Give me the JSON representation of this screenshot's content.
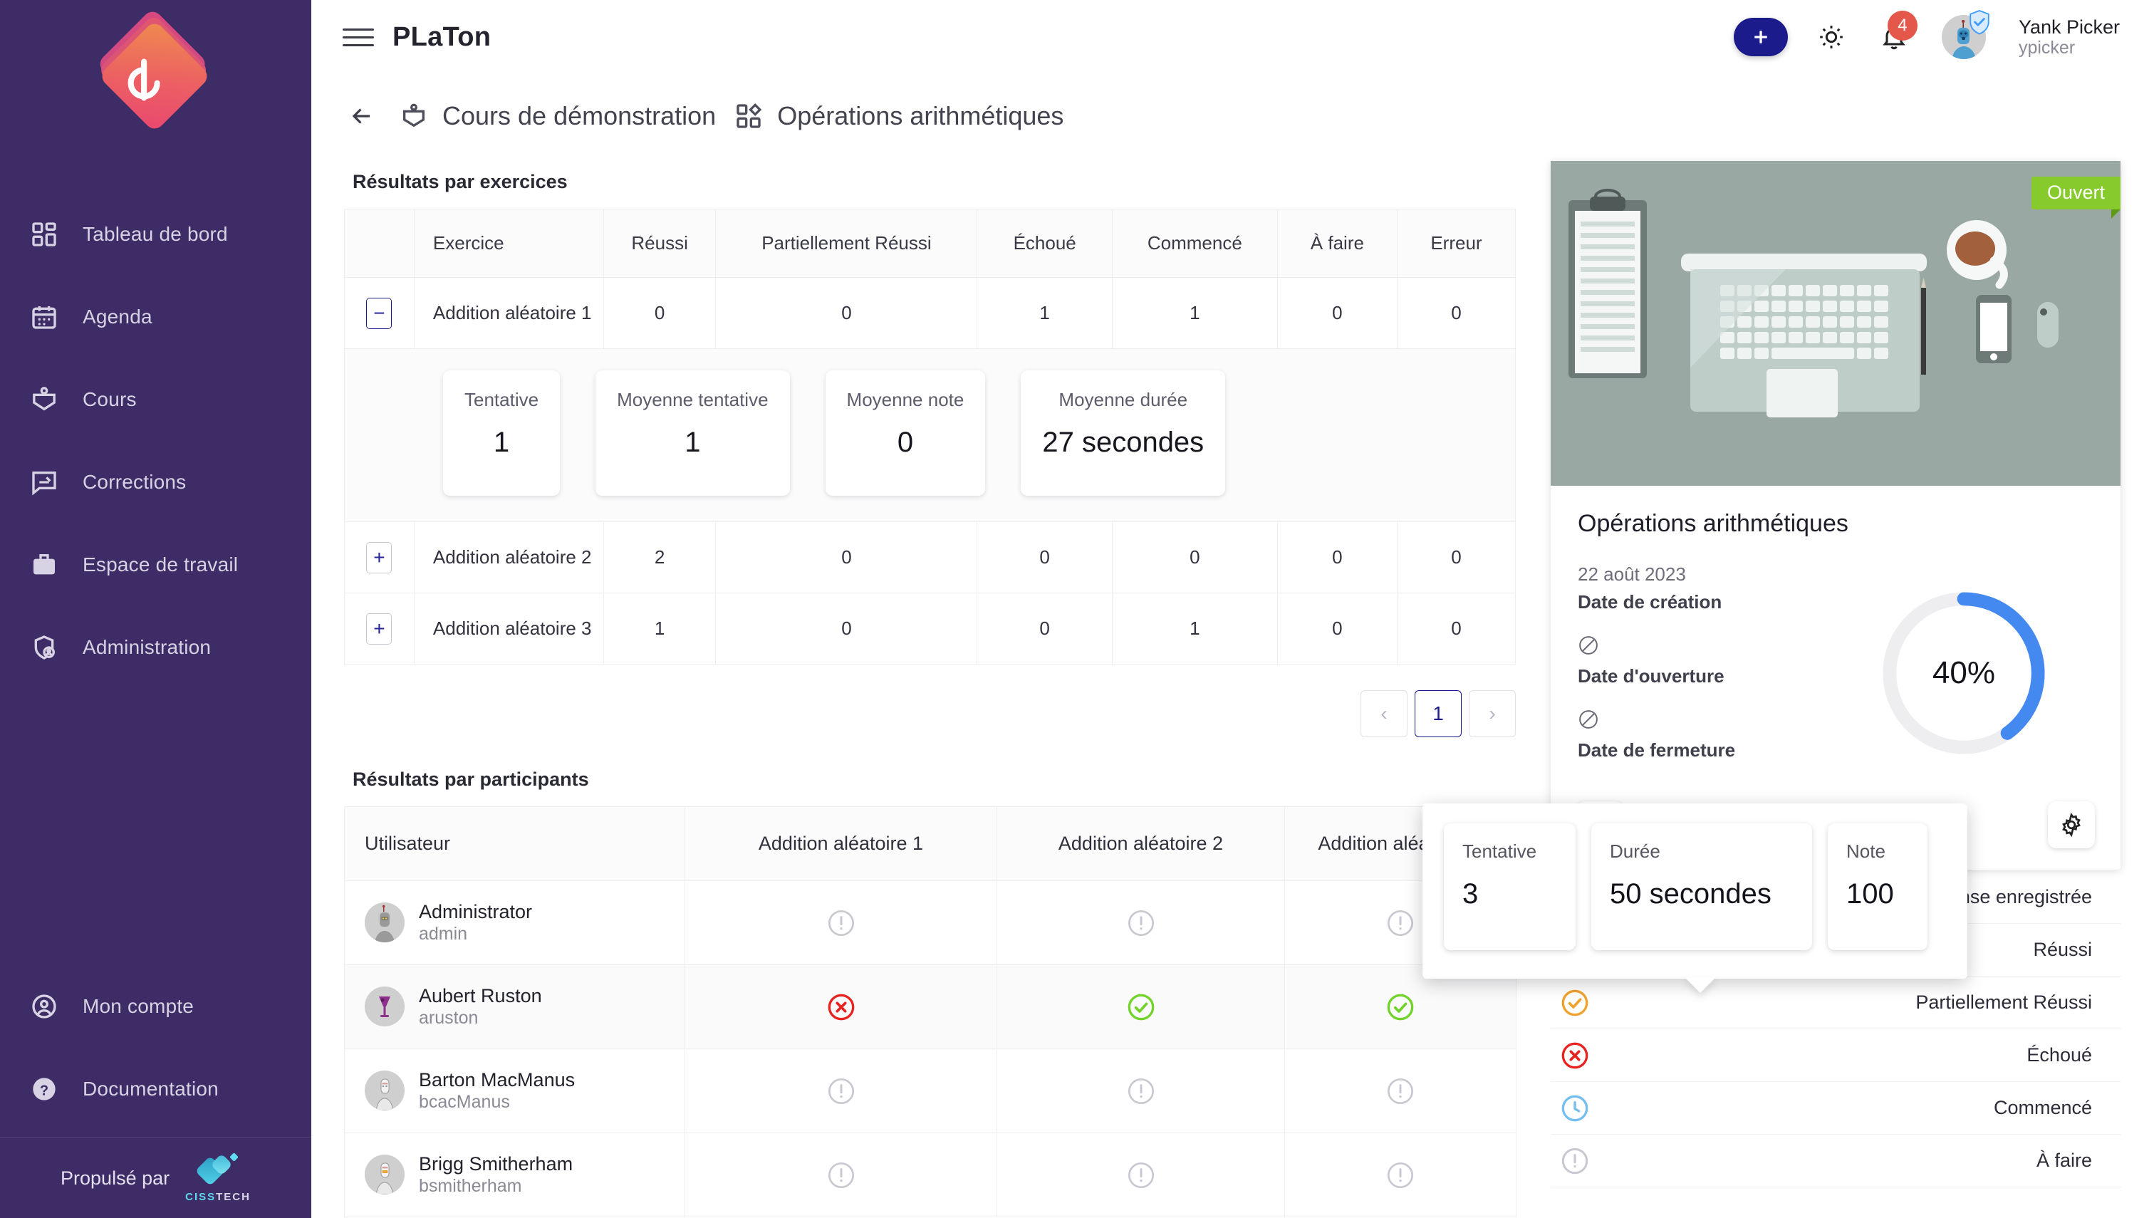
{
  "brand": {
    "title": "PLaTon"
  },
  "sidebar": {
    "items": [
      {
        "label": "Tableau de bord",
        "icon": "dashboard-icon"
      },
      {
        "label": "Agenda",
        "icon": "calendar-icon"
      },
      {
        "label": "Cours",
        "icon": "course-icon"
      },
      {
        "label": "Corrections",
        "icon": "edit-comment-icon"
      },
      {
        "label": "Espace de travail",
        "icon": "briefcase-icon"
      },
      {
        "label": "Administration",
        "icon": "shield-user-icon"
      }
    ],
    "bottom": [
      {
        "label": "Mon compte",
        "icon": "account-circle-icon"
      },
      {
        "label": "Documentation",
        "icon": "help-circle-icon"
      }
    ],
    "powered_by": "Propulsé par",
    "vendor_a": "CISS",
    "vendor_b": "TECH"
  },
  "topbar": {
    "add_label": "+",
    "notifications_count": "4",
    "user_name": "Yank Picker",
    "user_login": "ypicker"
  },
  "breadcrumb": {
    "course": "Cours de démonstration",
    "activity": "Opérations arithmétiques"
  },
  "exercises_section": {
    "title": "Résultats par exercices",
    "columns": [
      "Exercice",
      "Réussi",
      "Partiellement Réussi",
      "Échoué",
      "Commencé",
      "À faire",
      "Erreur"
    ],
    "rows": [
      {
        "expander": "−",
        "expanded": true,
        "name": "Addition aléatoire 1",
        "values": [
          "0",
          "0",
          "1",
          "1",
          "0",
          "0"
        ]
      },
      {
        "expander": "+",
        "expanded": false,
        "name": "Addition aléatoire 2",
        "values": [
          "2",
          "0",
          "0",
          "0",
          "0",
          "0"
        ]
      },
      {
        "expander": "+",
        "expanded": false,
        "name": "Addition aléatoire 3",
        "values": [
          "1",
          "0",
          "0",
          "1",
          "0",
          "0"
        ]
      }
    ],
    "expanded_stats": [
      {
        "label": "Tentative",
        "value": "1"
      },
      {
        "label": "Moyenne tentative",
        "value": "1"
      },
      {
        "label": "Moyenne note",
        "value": "0"
      },
      {
        "label": "Moyenne durée",
        "value": "27 secondes"
      }
    ],
    "pagination": {
      "prev": "‹",
      "page": "1",
      "next": "›"
    }
  },
  "participants_section": {
    "title": "Résultats par participants",
    "columns": [
      "Utilisateur",
      "Addition aléatoire 1",
      "Addition aléatoire 2",
      "Addition aléatoire 3"
    ],
    "rows": [
      {
        "name": "Administrator",
        "login": "admin",
        "statuses": [
          "todo",
          "todo",
          "todo"
        ]
      },
      {
        "name": "Aubert Ruston",
        "login": "aruston",
        "statuses": [
          "failed",
          "success",
          "success"
        ]
      },
      {
        "name": "Barton MacManus",
        "login": "bcacManus",
        "statuses": [
          "todo",
          "todo",
          "todo"
        ]
      },
      {
        "name": "Brigg Smitherham",
        "login": "bsmitherham",
        "statuses": [
          "todo",
          "todo",
          "todo"
        ]
      }
    ]
  },
  "popover": {
    "cards": [
      {
        "label": "Tentative",
        "value": "3"
      },
      {
        "label": "Durée",
        "value": "50 secondes"
      },
      {
        "label": "Note",
        "value": "100"
      }
    ]
  },
  "activity_panel": {
    "status_badge": "Ouvert",
    "title": "Opérations arithmétiques",
    "created_value": "22 août 2023",
    "created_label": "Date de création",
    "open_label": "Date d'ouverture",
    "close_label": "Date de fermeture",
    "progress_text": "40%",
    "progress_value": 40,
    "progress_color": "#4489ef",
    "progress_track": "#eeeef0",
    "chart_button": "bar-chart-icon",
    "settings_button": "gear-icon"
  },
  "legend": {
    "rows": [
      {
        "label": "Réponse enregistrée",
        "state": "saved",
        "color": "#3da0ef"
      },
      {
        "label": "Réussi",
        "state": "success",
        "color": "#72d32a"
      },
      {
        "label": "Partiellement Réussi",
        "state": "partial",
        "color": "#f0a22e"
      },
      {
        "label": "Échoué",
        "state": "failed",
        "color": "#e8231f"
      },
      {
        "label": "Commencé",
        "state": "started",
        "color": "#74bff0"
      },
      {
        "label": "À faire",
        "state": "todo",
        "color": "#c8c8d0"
      }
    ]
  },
  "colors": {
    "sidebar_bg": "#3d2c65",
    "accent": "#1c1b8c",
    "badge_red": "#e4574b",
    "open_green": "#86cb2b"
  }
}
